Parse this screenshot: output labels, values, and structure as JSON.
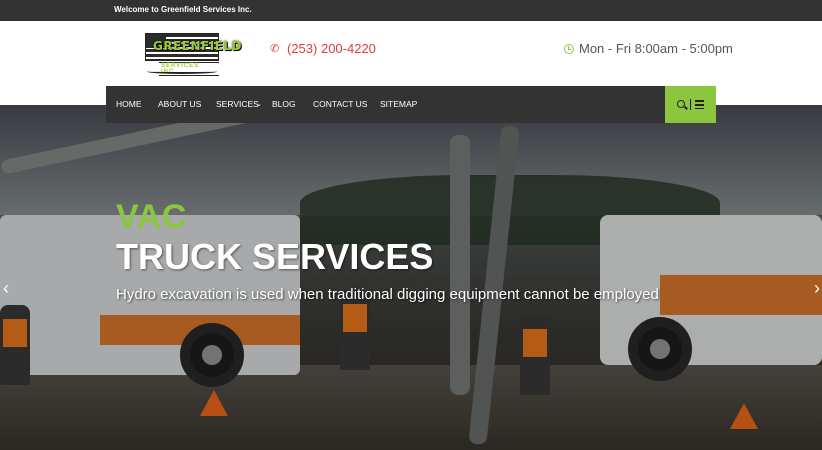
{
  "topbar": {
    "welcome": "Welcome to Greenfield Services Inc."
  },
  "logo": {
    "brand": "GREENFIELD",
    "sub": "SERVICES INC."
  },
  "contact": {
    "phone": "(253) 200-4220",
    "hours": "Mon - Fri 8:00am - 5:00pm"
  },
  "nav": {
    "items": [
      {
        "label": "HOME"
      },
      {
        "label": "ABOUT US"
      },
      {
        "label": "SERVICES"
      },
      {
        "label": "BLOG"
      },
      {
        "label": "CONTACT US"
      },
      {
        "label": "SITEMAP"
      }
    ]
  },
  "hero": {
    "headline_accent": "VAC",
    "headline_main": "TRUCK SERVICES",
    "subtitle": "Hydro excavation is used when traditional digging equipment cannot be employed"
  },
  "colors": {
    "accent_green": "#8cc63f",
    "phone_red": "#e23b3b",
    "dark_bar": "#333333"
  },
  "icons": [
    "phone-icon",
    "clock-icon",
    "search-icon",
    "menu-icon",
    "chevron-down-icon",
    "arrow-left-icon",
    "arrow-right-icon"
  ]
}
